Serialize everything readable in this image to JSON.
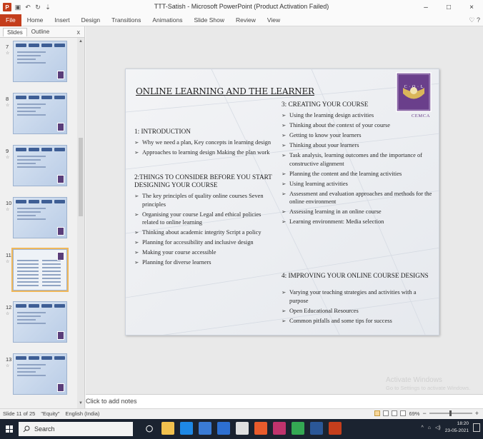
{
  "window": {
    "title": "TTT-Satish - Microsoft PowerPoint (Product Activation Failed)",
    "app_logo": "P",
    "qat_icons": [
      "save-icon",
      "undo-icon",
      "redo-icon",
      "customize-icon"
    ],
    "minimize": "–",
    "maximize": "□",
    "close": "×"
  },
  "ribbon": {
    "tabs": [
      "File",
      "Home",
      "Insert",
      "Design",
      "Transitions",
      "Animations",
      "Slide Show",
      "Review",
      "View"
    ],
    "help": "♡ ?"
  },
  "left_panel": {
    "tabs": [
      "Slides",
      "Outline"
    ],
    "close": "x",
    "thumbnails": [
      {
        "number": "7",
        "selected": false
      },
      {
        "number": "8",
        "selected": false
      },
      {
        "number": "9",
        "selected": false
      },
      {
        "number": "10",
        "selected": false
      },
      {
        "number": "11",
        "selected": true
      },
      {
        "number": "12",
        "selected": false
      },
      {
        "number": "13",
        "selected": false
      }
    ]
  },
  "slide": {
    "title": "ONLINE LEARNING AND THE LEARNER",
    "logo_letters": "C · O · L",
    "logo_name": "CEMCA",
    "sections": [
      {
        "heading": "1: INTRODUCTION",
        "bullets": [
          "Why we need a plan, Key concepts in learning design",
          "Approaches to learning design Making the plan work"
        ]
      },
      {
        "heading": "2:THINGS TO CONSIDER BEFORE YOU START DESIGNING YOUR COURSE",
        "bullets": [
          "The key principles of quality online courses Seven principles",
          "Organising your course Legal and ethical policies related to online learning",
          "Thinking about academic integrity Script a policy",
          "Planning for accessibility and inclusive design",
          "Making your course accessible",
          "Planning for diverse learners"
        ]
      },
      {
        "heading": "3: CREATING YOUR COURSE",
        "bullets": [
          "Using the learning design activities",
          "Thinking about the context of your course",
          "Getting to know your learners",
          "Thinking about your learners",
          "Task analysis, learning outcomes and the importance of constructive alignment",
          "Planning the content and the learning activities",
          "Using learning activities",
          "Assessment and evaluation approaches and methods for the online environment",
          "Assessing learning in an online course",
          "Learning environment: Media selection"
        ]
      },
      {
        "heading": "4: IMPROVING YOUR ONLINE COURSE DESIGNS",
        "bullets": [
          "Varying your teaching strategies and activities with a purpose",
          "Open Educational Resources",
          "Common pitfalls and some tips for success"
        ]
      }
    ]
  },
  "watermark": {
    "line1": "Activate Windows",
    "line2": "Go to Settings to activate Windows."
  },
  "notes": {
    "placeholder": "Click to add notes"
  },
  "statusbar": {
    "slide_info": "Slide 11 of 25",
    "theme": "\"Equity\"",
    "language": "English (India)",
    "zoom": "69%",
    "zoom_minus": "−",
    "zoom_plus": "+"
  },
  "taskbar": {
    "search_placeholder": "Search",
    "apps": [
      {
        "icon": "task-view-icon",
        "color": "#1b2330"
      },
      {
        "icon": "file-explorer-icon",
        "color": "#f2c14e"
      },
      {
        "icon": "edge-icon",
        "color": "#1e88e5"
      },
      {
        "icon": "store-icon",
        "color": "#3a7bd5"
      },
      {
        "icon": "mail-icon",
        "color": "#2d6fd0"
      },
      {
        "icon": "calendar-icon",
        "color": "#e0e0e0"
      },
      {
        "icon": "office-icon",
        "color": "#e95b2c"
      },
      {
        "icon": "photos-icon",
        "color": "#c0336d"
      },
      {
        "icon": "chrome-icon",
        "color": "#34a853"
      },
      {
        "icon": "word-icon",
        "color": "#2b5797"
      },
      {
        "icon": "powerpoint-icon",
        "color": "#c43e1c"
      }
    ],
    "time": "18:20",
    "date": "23-05-2021"
  }
}
